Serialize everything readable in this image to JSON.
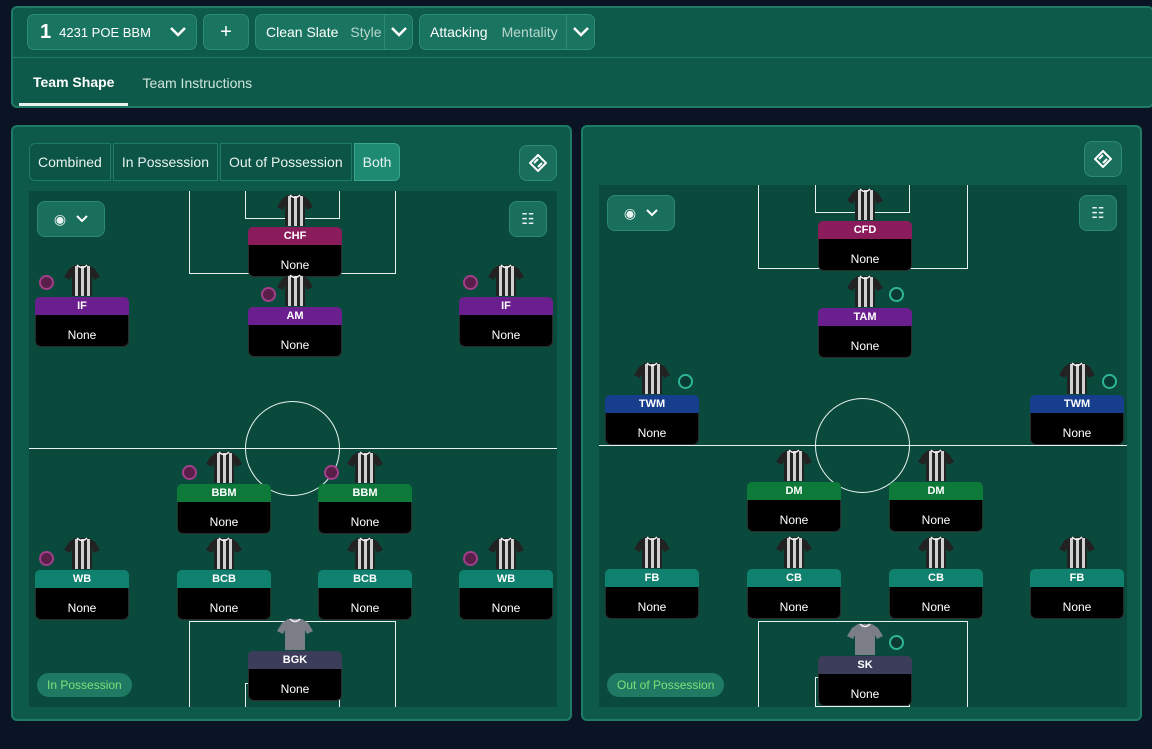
{
  "tactic": {
    "number": "1",
    "name": "4231 POE BBM",
    "add_label": "+"
  },
  "style": {
    "value": "Clean Slate",
    "label": "Style"
  },
  "mentality": {
    "value": "Attacking",
    "label": "Mentality"
  },
  "tabs": [
    "Team Shape",
    "Team Instructions"
  ],
  "left_panel": {
    "segments": [
      "Combined",
      "In Possession",
      "Out of Possession",
      "Both"
    ],
    "active_segment": "Both",
    "phase_label": "In Possession",
    "players": [
      {
        "role": "CHF",
        "duty": "None",
        "color": "#8b1c5c"
      },
      {
        "role": "IF",
        "duty": "None",
        "color": "#6b1f8f"
      },
      {
        "role": "AM",
        "duty": "None",
        "color": "#6b1f8f"
      },
      {
        "role": "IF",
        "duty": "None",
        "color": "#6b1f8f"
      },
      {
        "role": "BBM",
        "duty": "None",
        "color": "#0e7a3a"
      },
      {
        "role": "BBM",
        "duty": "None",
        "color": "#0e7a3a"
      },
      {
        "role": "WB",
        "duty": "None",
        "color": "#10806f"
      },
      {
        "role": "BCB",
        "duty": "None",
        "color": "#10806f"
      },
      {
        "role": "BCB",
        "duty": "None",
        "color": "#10806f"
      },
      {
        "role": "WB",
        "duty": "None",
        "color": "#10806f"
      },
      {
        "role": "BGK",
        "duty": "None",
        "color": "#3b3d5a"
      }
    ]
  },
  "right_panel": {
    "phase_label": "Out of Possession",
    "players": [
      {
        "role": "CFD",
        "duty": "None",
        "color": "#8b1c5c"
      },
      {
        "role": "TAM",
        "duty": "None",
        "color": "#6b1f8f"
      },
      {
        "role": "TWM",
        "duty": "None",
        "color": "#163e8c"
      },
      {
        "role": "TWM",
        "duty": "None",
        "color": "#163e8c"
      },
      {
        "role": "DM",
        "duty": "None",
        "color": "#0e7a3a"
      },
      {
        "role": "DM",
        "duty": "None",
        "color": "#0e7a3a"
      },
      {
        "role": "FB",
        "duty": "None",
        "color": "#10806f"
      },
      {
        "role": "CB",
        "duty": "None",
        "color": "#10806f"
      },
      {
        "role": "CB",
        "duty": "None",
        "color": "#10806f"
      },
      {
        "role": "FB",
        "duty": "None",
        "color": "#10806f"
      },
      {
        "role": "SK",
        "duty": "None",
        "color": "#3b3d5a"
      }
    ]
  },
  "icons": [
    "chevron-down-icon",
    "plus-icon",
    "eye-icon",
    "formation-grid-icon",
    "pitch-swap-icon"
  ]
}
